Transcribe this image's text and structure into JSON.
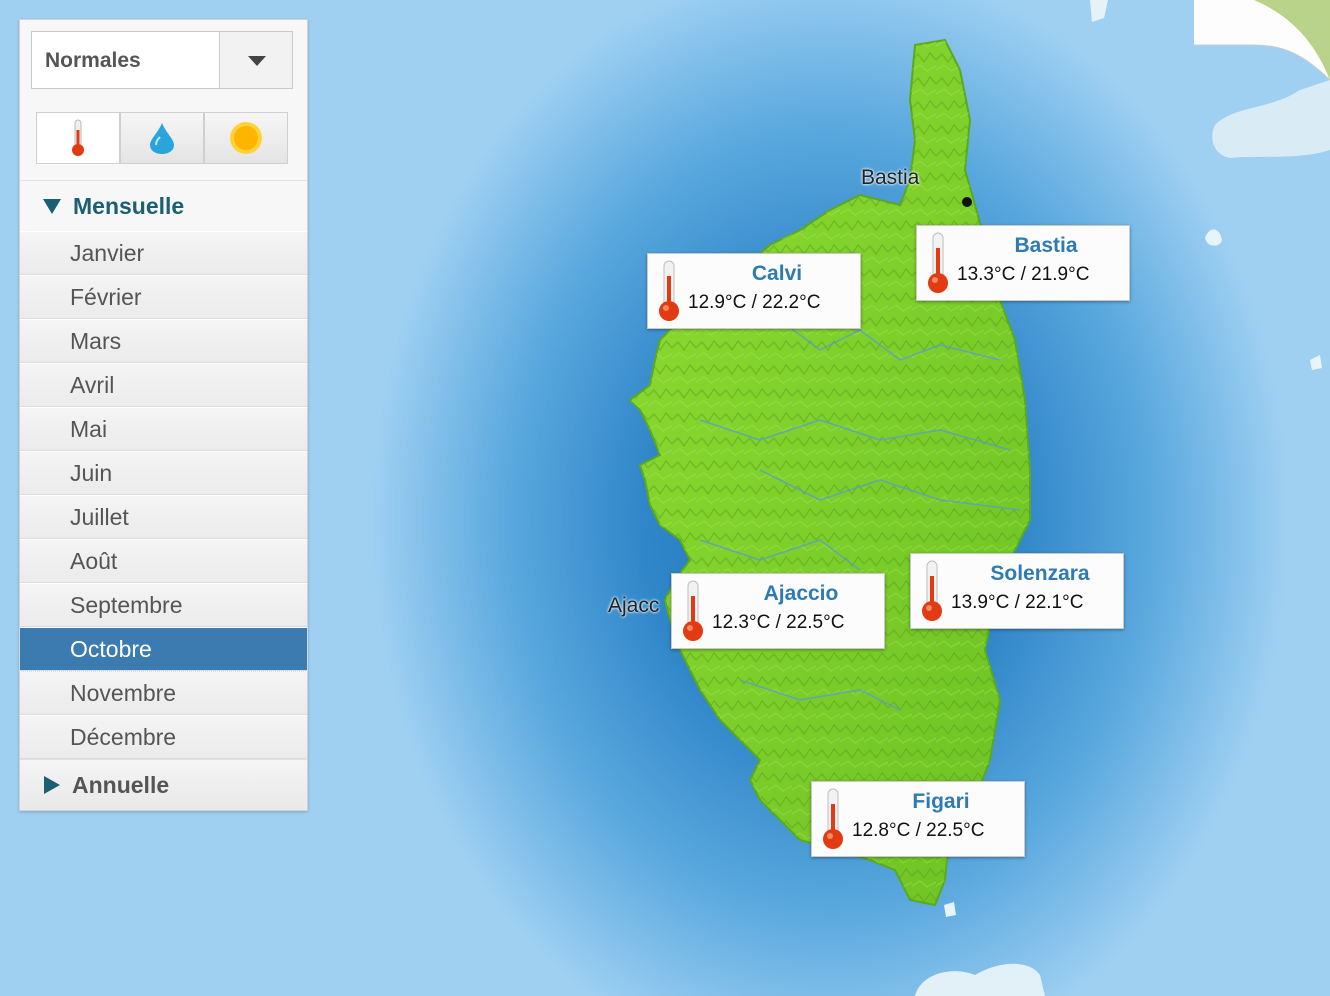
{
  "selector": {
    "value": "Normales"
  },
  "parameters": [
    {
      "icon": "thermometer-icon",
      "active": true
    },
    {
      "icon": "water-drop-icon",
      "active": false
    },
    {
      "icon": "sun-icon",
      "active": false
    }
  ],
  "sections": {
    "monthly": "Mensuelle",
    "annual": "Annuelle"
  },
  "months": [
    "Janvier",
    "Février",
    "Mars",
    "Avril",
    "Mai",
    "Juin",
    "Juillet",
    "Août",
    "Septembre",
    "Octobre",
    "Novembre",
    "Décembre"
  ],
  "selected_month": "Octobre",
  "map_labels": {
    "bastia": "Bastia",
    "ajaccio": "Ajacc"
  },
  "stations": [
    {
      "name": "Calvi",
      "temps": "12.9°C / 22.2°C"
    },
    {
      "name": "Bastia",
      "temps": "13.3°C / 21.9°C"
    },
    {
      "name": "Ajaccio",
      "temps": "12.3°C / 22.5°C"
    },
    {
      "name": "Solenzara",
      "temps": "13.9°C / 22.1°C"
    },
    {
      "name": "Figari",
      "temps": "12.8°C / 22.5°C"
    }
  ],
  "colors": {
    "sea": "#2f86c8",
    "land": "#7ccf2a",
    "accent": "#3b7baf",
    "station_name": "#2e7bb4"
  }
}
